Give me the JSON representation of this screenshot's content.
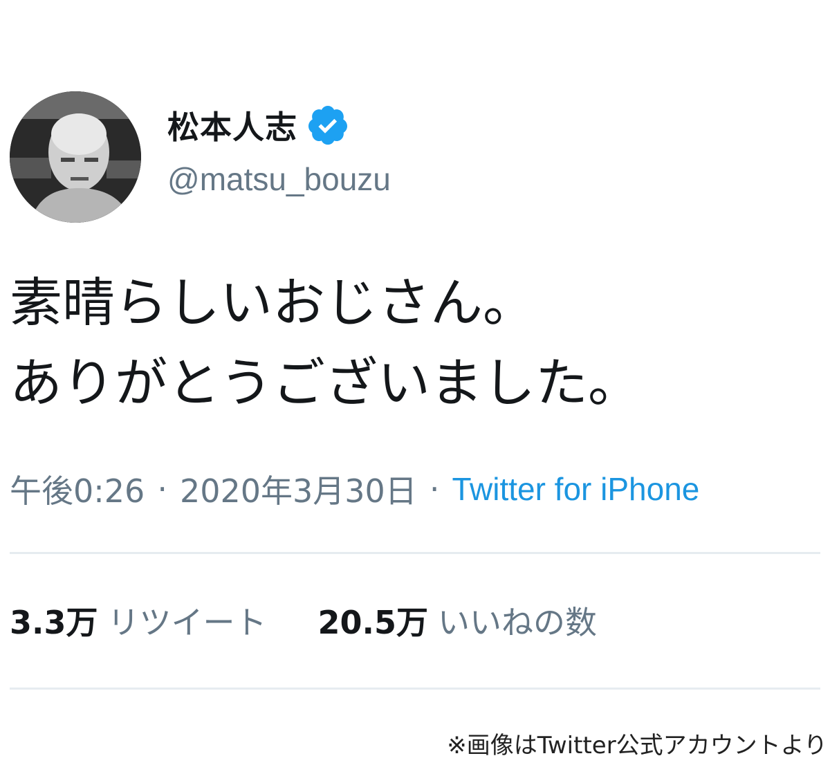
{
  "tweet": {
    "author": {
      "display_name": "松本人志",
      "handle": "@matsu_bouzu",
      "verified_icon": "verified-badge-icon",
      "avatar_icon": "profile-avatar"
    },
    "text_lines": [
      "素晴らしいおじさん。",
      "ありがとうございました。"
    ],
    "meta": {
      "time": "午後0:26",
      "separator": "·",
      "date": "2020年3月30日",
      "source": "Twitter for iPhone"
    },
    "stats": {
      "retweets_count": "3.3万",
      "retweets_label": "リツイート",
      "likes_count": "20.5万",
      "likes_label": "いいねの数"
    }
  },
  "credit": "※画像はTwitter公式アカウントより",
  "colors": {
    "text_primary": "#14171a",
    "text_secondary": "#657786",
    "link": "#1b95e0",
    "verified": "#1da1f2",
    "divider": "#e6ecf0"
  }
}
